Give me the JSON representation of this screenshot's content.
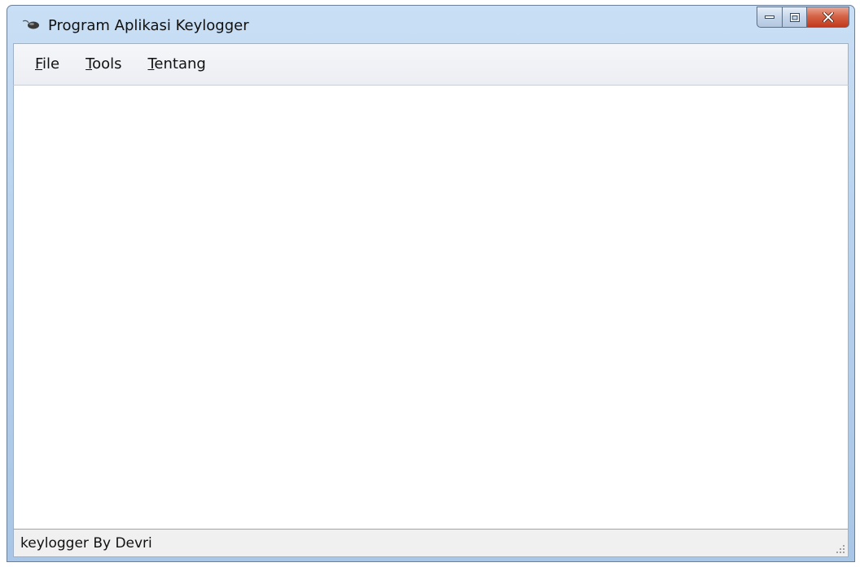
{
  "window": {
    "title": "Program Aplikasi Keylogger",
    "icon": "app-mouse-icon"
  },
  "caption_buttons": {
    "minimize_icon": "minimize-icon",
    "maximize_icon": "maximize-icon",
    "close_icon": "close-icon"
  },
  "menubar": {
    "items": [
      {
        "mnemonic": "F",
        "rest": "ile"
      },
      {
        "mnemonic": "T",
        "rest": "ools"
      },
      {
        "mnemonic": "T",
        "rest": "entang"
      }
    ]
  },
  "statusbar": {
    "text": "keylogger By Devri",
    "grip_icon": "resize-grip-icon"
  },
  "colors": {
    "title_bar": "#b8d2ee",
    "close_button": "#c2391d",
    "content_background": "#ffffff",
    "status_background": "#f0f0f0"
  }
}
